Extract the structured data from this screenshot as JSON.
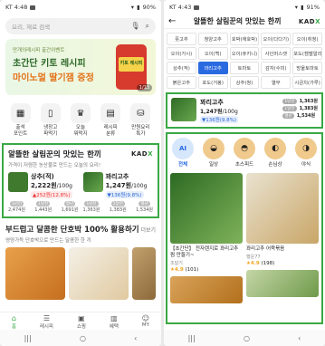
{
  "left": {
    "status": {
      "time": "KT 4:48",
      "battery": "90%"
    },
    "search": {
      "placeholder": "요리, 재료 검색"
    },
    "banner": {
      "sub": "만개의레시피 출간이벤트",
      "title1": "초간단 키토 레시피",
      "title2": "마이노멀 딸기잼 증정",
      "jar_label": "키토 레시피",
      "counter": "1/13"
    },
    "categories": [
      {
        "icon": "calendar-icon",
        "label": "출석\n포인트"
      },
      {
        "icon": "fridge-icon",
        "label": "냉장고\n파먹기"
      },
      {
        "icon": "trophy-icon",
        "label": "오늘\n뭐먹지"
      },
      {
        "icon": "book-icon",
        "label": "레시피\n분류"
      },
      {
        "icon": "shopping-icon",
        "label": "만원요리\n특가"
      }
    ],
    "section1": {
      "title": "알뜰한 살림꾼의 맛있는 한끼",
      "brand_a": "KAD",
      "brand_b": "X",
      "subtitle": "가격이 저렴한 농산물로 만드는 오늘의 요리!",
      "items": [
        {
          "name": "상추(적)",
          "price": "2,222원",
          "unit": "/100g",
          "change": "▲252원(12.8%)",
          "dir": "up",
          "mini": [
            {
              "label": "1년전",
              "value": "2,474원"
            },
            {
              "label": "1달전",
              "value": "1,443원"
            },
            {
              "label": "평년",
              "value": "1,691원"
            }
          ]
        },
        {
          "name": "꽈리고추",
          "price": "1,247원",
          "unit": "/100g",
          "change": "▼136원(9.8%)",
          "dir": "down",
          "mini": [
            {
              "label": "1년전",
              "value": "1,363원"
            },
            {
              "label": "1달전",
              "value": "1,383원"
            },
            {
              "label": "평년",
              "value": "1,534원"
            }
          ]
        }
      ]
    },
    "section2": {
      "title": "부드럽고 달콤한 단호박 100% 활용하기",
      "more": "더보기",
      "subtitle": "영양가득 단호박으로 만드는 달콤한 한 끼"
    },
    "tabs": [
      {
        "icon": "home-icon",
        "label": "홈"
      },
      {
        "icon": "recipe-icon",
        "label": "레시피"
      },
      {
        "icon": "shop-icon",
        "label": "쇼핑"
      },
      {
        "icon": "gift-icon",
        "label": "혜택"
      },
      {
        "icon": "user-icon",
        "label": "MY"
      }
    ]
  },
  "right": {
    "status": {
      "time": "KT 4:43",
      "battery": "91%"
    },
    "header": {
      "title": "알뜰한 살림꾼의 맛있는 한끼",
      "brand_a": "KAD",
      "brand_b": "X"
    },
    "grid": [
      "풋고추",
      "청양고추",
      "호박(애호박)",
      "오이(다다기)",
      "오이(취청)",
      "오이(가시)",
      "오이(백)",
      "오이(쥬키니)",
      "사인머스캣",
      "포도(캠벨얼리)",
      "상추(적)",
      "꽈리고추",
      "토마토",
      "감자(수미)",
      "방울토마토",
      "붉은고추",
      "포도(거봉)",
      "상추(청)",
      "열무",
      "시금치(가루)"
    ],
    "selected_grid": "꽈리고추",
    "item": {
      "name": "꽈리고추",
      "price": "1,247원",
      "unit": "/100g",
      "change": "▼136원(9.8%)",
      "stats": [
        {
          "label": "1년전",
          "value": "1,363원"
        },
        {
          "label": "1달전",
          "value": "1,383원"
        },
        {
          "label": "평년",
          "value": "1,534원"
        }
      ]
    },
    "chips": [
      {
        "label": "전체",
        "icon": "AI",
        "selected": true
      },
      {
        "label": "일상",
        "icon": "bowl-icon",
        "selected": false
      },
      {
        "label": "초스피드",
        "icon": "fast-icon",
        "selected": false
      },
      {
        "label": "손님상",
        "icon": "dish-icon",
        "selected": false
      },
      {
        "label": "야식",
        "icon": "night-icon",
        "selected": false
      }
    ],
    "cards": [
      {
        "title": "【초간단】 전자렌지로 꽈리고추찜 만들기~",
        "author": "조달기",
        "rating": "★4.9",
        "reviews": "(101)"
      },
      {
        "title": "꽈리고추 어묵볶음",
        "author": "행운77",
        "rating": "★4.9",
        "reviews": "(198)"
      }
    ]
  }
}
